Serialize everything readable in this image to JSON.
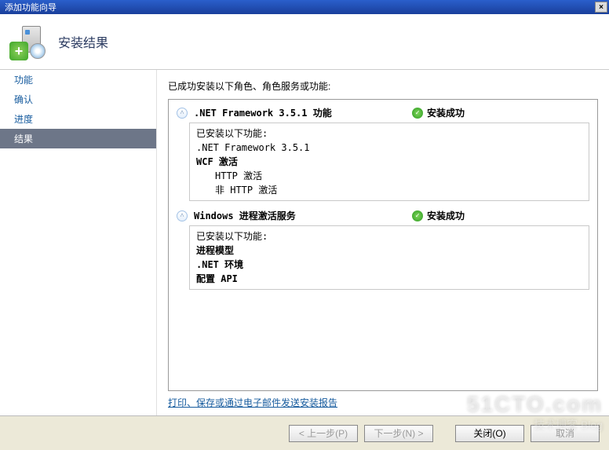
{
  "window": {
    "title": "添加功能向导",
    "close_label": "×"
  },
  "header": {
    "title": "安装结果"
  },
  "sidebar": {
    "items": [
      {
        "label": "功能",
        "selected": false
      },
      {
        "label": "确认",
        "selected": false
      },
      {
        "label": "进度",
        "selected": false
      },
      {
        "label": "结果",
        "selected": true
      }
    ]
  },
  "content": {
    "intro": "已成功安装以下角色、角色服务或功能:",
    "groups": [
      {
        "title": ".NET Framework 3.5.1 功能",
        "status": "安装成功",
        "body_intro": "已安装以下功能:",
        "items": [
          {
            "text": ".NET Framework 3.5.1",
            "indent": 0,
            "bold": false
          },
          {
            "text": "WCF 激活",
            "indent": 0,
            "bold": true
          },
          {
            "text": "HTTP 激活",
            "indent": 1,
            "bold": false
          },
          {
            "text": "非 HTTP 激活",
            "indent": 1,
            "bold": false
          }
        ]
      },
      {
        "title": "Windows 进程激活服务",
        "status": "安装成功",
        "body_intro": "已安装以下功能:",
        "items": [
          {
            "text": "进程模型",
            "indent": 0,
            "bold": true
          },
          {
            "text": ".NET 环境",
            "indent": 0,
            "bold": true
          },
          {
            "text": "配置 API",
            "indent": 0,
            "bold": true
          }
        ]
      }
    ],
    "link_text": "打印、保存或通过电子邮件发送安装报告"
  },
  "footer": {
    "prev": "< 上一步(P)",
    "next": "下一步(N) >",
    "close": "关闭(O)",
    "cancel": "取消"
  },
  "watermark": {
    "line1": "51CTO.com",
    "line2": "技术博客  Blog"
  }
}
